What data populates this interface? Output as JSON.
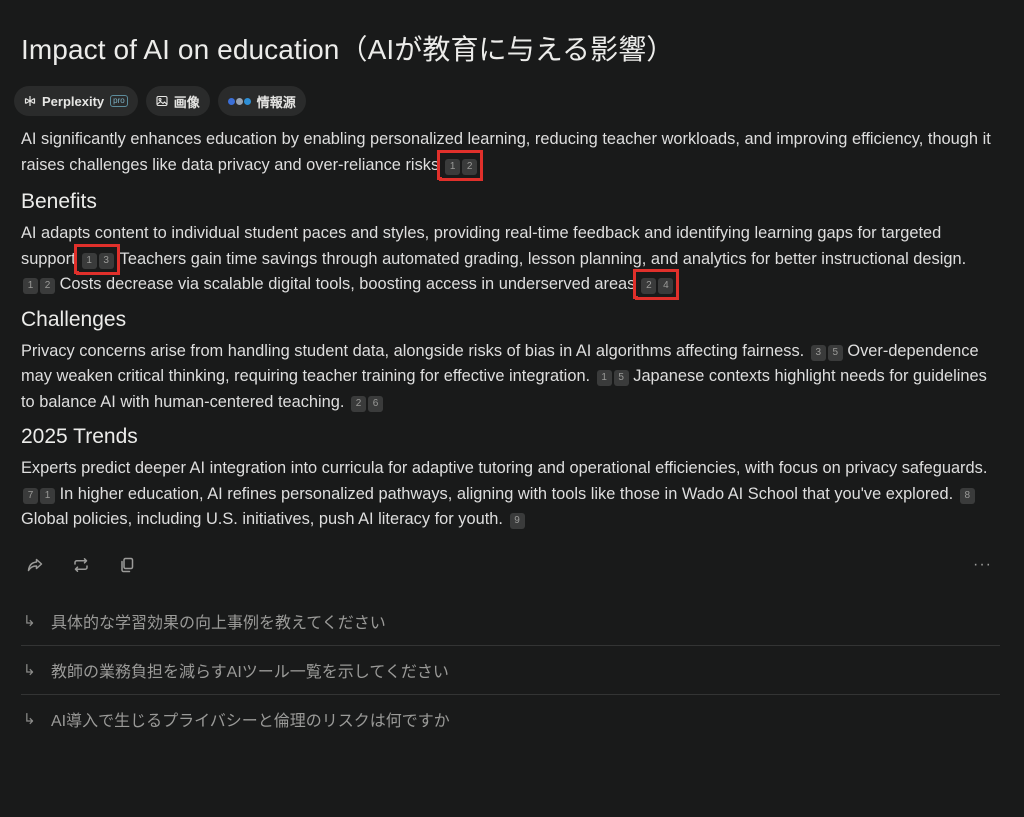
{
  "title": "Impact of AI on education（AIが教育に与える影響）",
  "tabs": [
    {
      "label": "Perplexity",
      "badge": "pro",
      "icon": "perplexity-logo-icon"
    },
    {
      "label": "画像",
      "icon": "image-icon"
    },
    {
      "label": "情報源",
      "icon": "source-favicons-icon"
    }
  ],
  "answer": {
    "intro": "AI significantly enhances education by enabling personalized learning, reducing teacher workloads, and improving efficiency, though it raises challenges like data privacy and over-reliance risks",
    "intro_cites": [
      "1",
      "2"
    ],
    "sections": [
      {
        "heading": "Benefits",
        "s1": "AI adapts content to individual student paces and styles, providing real-time feedback and identifying learning gaps for targeted support",
        "c1": [
          "1",
          "3"
        ],
        "s2": "Teachers gain time savings through automated grading, lesson planning, and analytics for better instructional design.",
        "c2": [
          "1",
          "2"
        ],
        "s3": "Costs decrease via scalable digital tools, boosting access in underserved areas",
        "c3": [
          "2",
          "4"
        ]
      },
      {
        "heading": "Challenges",
        "s1": "Privacy concerns arise from handling student data, alongside risks of bias in AI algorithms affecting fairness.",
        "c1": [
          "3",
          "5"
        ],
        "s2": "Over-dependence may weaken critical thinking, requiring teacher training for effective integration.",
        "c2": [
          "1",
          "5"
        ],
        "s3": "Japanese contexts highlight needs for guidelines to balance AI with human-centered teaching.",
        "c3": [
          "2",
          "6"
        ]
      },
      {
        "heading": "2025 Trends",
        "s1": "Experts predict deeper AI integration into curricula for adaptive tutoring and operational efficiencies, with focus on privacy safeguards.",
        "c1": [
          "7",
          "1"
        ],
        "s2": "In higher education, AI refines personalized pathways, aligning with tools like those in Wado AI School that you've explored.",
        "c2": [
          "8"
        ],
        "s3": "Global policies, including U.S. initiatives, push AI literacy for youth.",
        "c3": [
          "9"
        ]
      }
    ]
  },
  "actions": [
    {
      "icon": "share-icon"
    },
    {
      "icon": "rewrite-icon"
    },
    {
      "icon": "copy-icon"
    },
    {
      "icon": "more-icon",
      "label": "···"
    }
  ],
  "related": [
    {
      "text": "具体的な学習効果の向上事例を教えてください",
      "arrow": "↳"
    },
    {
      "text": "教師の業務負担を減らすAIツール一覧を示してください",
      "arrow": "↳"
    },
    {
      "text": "AI導入で生じるプライバシーと倫理のリスクは何ですか",
      "arrow": "↳"
    }
  ],
  "colors": {
    "background": "#191a1a",
    "text": "#dedede",
    "highlight_box": "#e0302b",
    "citation_bg": "#3a3b3b",
    "muted": "#9a9a98"
  }
}
